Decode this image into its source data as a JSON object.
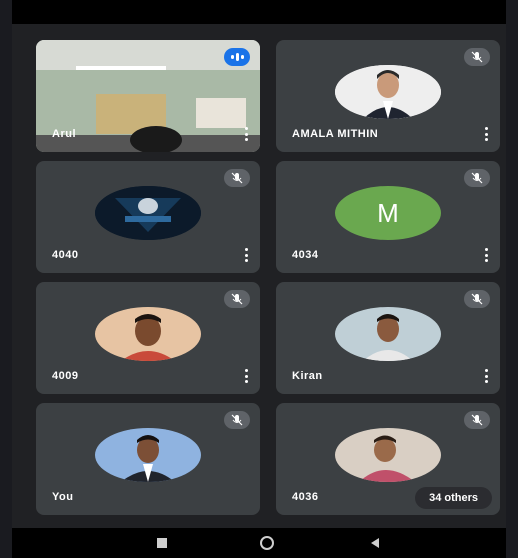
{
  "participants": [
    {
      "name": "Arul",
      "status": "speaking",
      "avatar": "camera-video"
    },
    {
      "name": "AMALA MITHIN",
      "status": "muted",
      "avatar": "photo-man-suit"
    },
    {
      "name": "4040",
      "status": "muted",
      "avatar": "photo-logo"
    },
    {
      "name": "4034",
      "status": "muted",
      "avatar": "letter",
      "letter": "M",
      "color": "#6aa84f"
    },
    {
      "name": "4009",
      "status": "muted",
      "avatar": "photo-man"
    },
    {
      "name": "Kiran",
      "status": "muted",
      "avatar": "photo-man"
    },
    {
      "name": "You",
      "status": "muted",
      "avatar": "photo-man-suit"
    },
    {
      "name": "4036",
      "status": "muted",
      "avatar": "photo-man"
    }
  ],
  "others_label": "34 others",
  "nav": {
    "recent": "recent-apps-icon",
    "home": "home-icon",
    "back": "back-icon"
  },
  "colors": {
    "tile": "#3c4043",
    "background": "#202124",
    "speaking": "#1a73e8",
    "muted_badge": "#5f6368"
  }
}
